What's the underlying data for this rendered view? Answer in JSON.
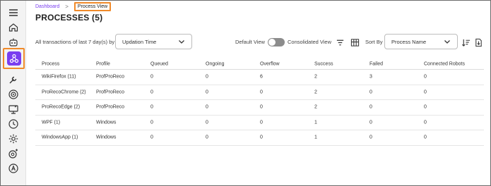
{
  "breadcrumb": {
    "home": "Dashboard",
    "separator": ">",
    "current": "Process View"
  },
  "page": {
    "title": "PROCESSES (5)"
  },
  "filters": {
    "transactions_label": "All transactions of last 7 day(s) by",
    "time_select": "Updation Time",
    "default_view_label": "Default View",
    "consolidated_view_label": "Consolidated View",
    "sort_by_label": "Sort By",
    "sort_select": "Process Name"
  },
  "sidebar": {
    "items": [
      "menu-icon",
      "home-icon",
      "robot-icon",
      "process-icon",
      "wrench-icon",
      "target-icon",
      "monitor-icon",
      "clock-icon",
      "settings-icon",
      "gear-user-icon",
      "admin-icon"
    ],
    "active": "process-icon",
    "accent": "#7a3ef0",
    "highlight": "#f08a2a"
  },
  "table": {
    "columns": [
      "Process",
      "Profile",
      "Queued",
      "Ongoing",
      "Overflow",
      "Success",
      "Failed",
      "Connected Robots"
    ],
    "rows": [
      [
        "WikiFirefox (11)",
        "ProfProReco",
        "0",
        "0",
        "6",
        "2",
        "3",
        "0"
      ],
      [
        "ProRecoChrome (2)",
        "ProfProReco",
        "0",
        "0",
        "0",
        "2",
        "0",
        "0"
      ],
      [
        "ProRecoEdge (2)",
        "ProfProReco",
        "0",
        "0",
        "0",
        "2",
        "0",
        "0"
      ],
      [
        "WPF (1)",
        "Windows",
        "0",
        "0",
        "0",
        "1",
        "0",
        "0"
      ],
      [
        "WindowsApp (1)",
        "Windows",
        "0",
        "0",
        "0",
        "1",
        "0",
        "0"
      ]
    ]
  }
}
